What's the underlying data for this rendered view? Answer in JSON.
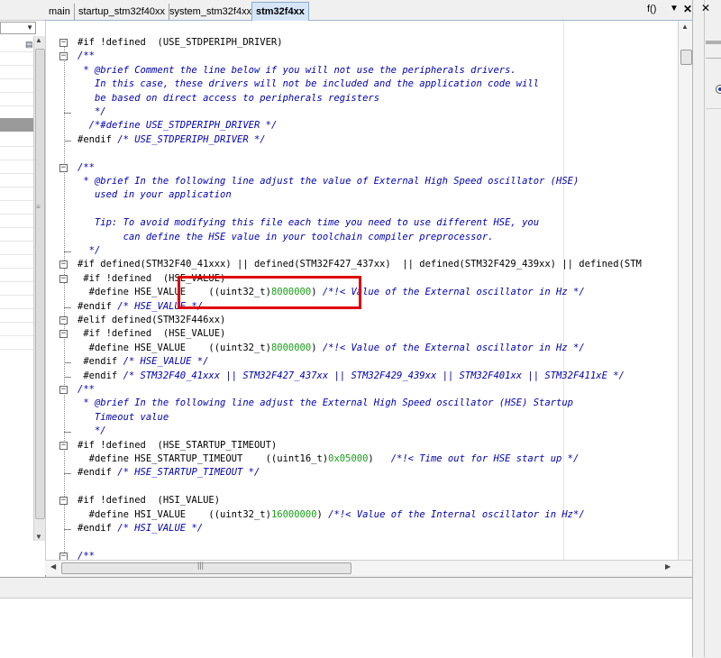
{
  "tabs": [
    {
      "label": "main",
      "active": false
    },
    {
      "label": "startup_stm32f40xx",
      "active": false
    },
    {
      "label": "system_stm32f4xx",
      "active": false
    },
    {
      "label": "stm32f4xx",
      "active": true
    }
  ],
  "tabbar": {
    "function_label": "f()",
    "menu_icon": "chevron-down-icon",
    "close_icon": "close-icon"
  },
  "editor": {
    "lines": [
      {
        "text": "#if !defined  (USE_STDPERIPH_DRIVER)"
      },
      {
        "text": "/**"
      },
      {
        "text": " * @brief Comment the line below if you will not use the peripherals drivers."
      },
      {
        "text": "   In this case, these drivers will not be included and the application code will"
      },
      {
        "text": "   be based on direct access to peripherals registers"
      },
      {
        "text": "   */"
      },
      {
        "text": "  /*#define USE_STDPERIPH_DRIVER */"
      },
      {
        "text": "#endif /* USE_STDPERIPH_DRIVER */"
      },
      {
        "text": ""
      },
      {
        "text": "/**"
      },
      {
        "text": " * @brief In the following line adjust the value of External High Speed oscillator (HSE)"
      },
      {
        "text": "   used in your application"
      },
      {
        "text": ""
      },
      {
        "text": "   Tip: To avoid modifying this file each time you need to use different HSE, you"
      },
      {
        "text": "        can define the HSE value in your toolchain compiler preprocessor."
      },
      {
        "text": "  */"
      },
      {
        "text": "#if defined(STM32F40_41xxx) || defined(STM32F427_437xx)  || defined(STM32F429_439xx) || defined(STM"
      },
      {
        "text": " #if !defined  (HSE_VALUE)"
      },
      {
        "text": "  #define HSE_VALUE    ((uint32_t)8000000) /*!< Value of the External oscillator in Hz */"
      },
      {
        "text": "#endif /* HSE_VALUE */"
      },
      {
        "text": "#elif defined(STM32F446xx)"
      },
      {
        "text": " #if !defined  (HSE_VALUE)"
      },
      {
        "text": "  #define HSE_VALUE    ((uint32_t)8000000) /*!< Value of the External oscillator in Hz */"
      },
      {
        "text": " #endif /* HSE_VALUE */"
      },
      {
        "text": " #endif /* STM32F40_41xxx || STM32F427_437xx || STM32F429_439xx || STM32F401xx || STM32F411xE */"
      },
      {
        "text": "/**"
      },
      {
        "text": " * @brief In the following line adjust the External High Speed oscillator (HSE) Startup"
      },
      {
        "text": "   Timeout value"
      },
      {
        "text": "   */"
      },
      {
        "text": "#if !defined  (HSE_STARTUP_TIMEOUT)"
      },
      {
        "text": "  #define HSE_STARTUP_TIMEOUT    ((uint16_t)0x05000)   /*!< Time out for HSE start up */"
      },
      {
        "text": "#endif /* HSE_STARTUP_TIMEOUT */"
      },
      {
        "text": ""
      },
      {
        "text": "#if !defined  (HSI_VALUE)"
      },
      {
        "text": "  #define HSI_VALUE    ((uint32_t)16000000) /*!< Value of the Internal oscillator in Hz*/"
      },
      {
        "text": "#endif /* HSI_VALUE */"
      },
      {
        "text": ""
      },
      {
        "text": "/**"
      }
    ]
  },
  "colors": {
    "comment": "#0000b0",
    "number": "#18a018",
    "highlight": "#e00000",
    "active_tab": "#d6e6f7"
  }
}
